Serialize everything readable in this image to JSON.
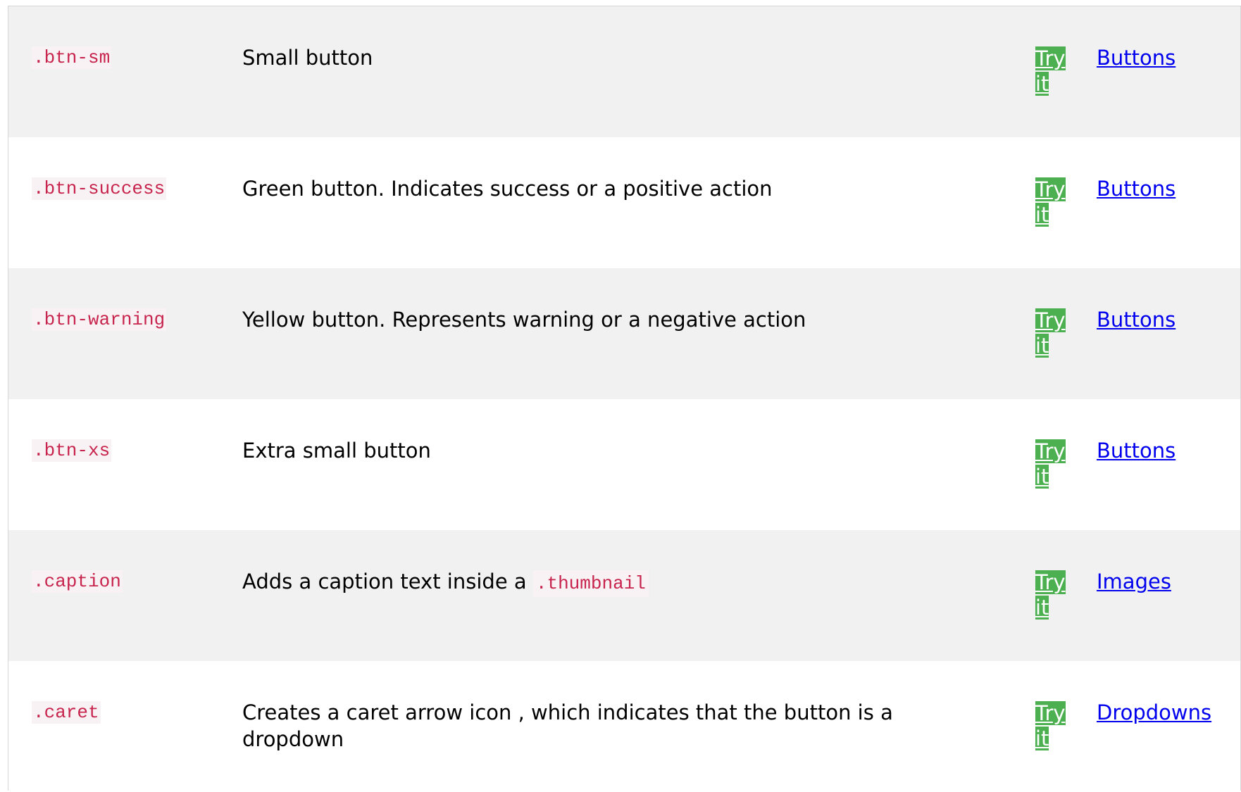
{
  "table": {
    "rows": [
      {
        "class": ".btn-sm",
        "description": "Small button",
        "try_it": "Try it",
        "reference": "Buttons"
      },
      {
        "class": ".btn-success",
        "description": "Green button. Indicates success or a positive action",
        "try_it": "Try it",
        "reference": "Buttons"
      },
      {
        "class": ".btn-warning",
        "description": "Yellow button. Represents warning or a negative action",
        "try_it": "Try it",
        "reference": "Buttons"
      },
      {
        "class": ".btn-xs",
        "description": "Extra small button",
        "try_it": "Try it",
        "reference": "Buttons"
      },
      {
        "class": ".caption",
        "description": "Adds a caption text inside a",
        "description_code": ".thumbnail",
        "try_it": "Try it",
        "reference": "Images"
      },
      {
        "class": ".caret",
        "description": "Creates a caret arrow icon , which indicates that the button is a dropdown",
        "try_it": "Try it",
        "reference": "Dropdowns"
      }
    ]
  },
  "colors": {
    "code_text": "#c7254e",
    "code_background": "#f9f2f4",
    "try_it_background": "#4caf50",
    "link": "#0000ee",
    "stripe": "#f1f1f1"
  }
}
